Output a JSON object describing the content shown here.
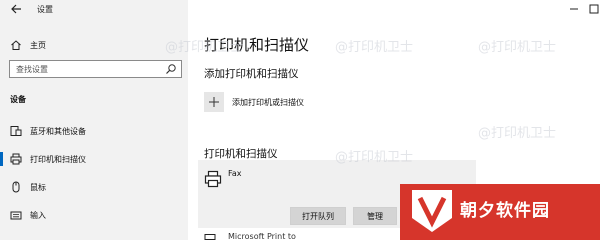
{
  "app": {
    "title": "设置"
  },
  "sidebar": {
    "home_label": "主页",
    "search_placeholder": "查找设置",
    "section_label": "设备",
    "items": [
      {
        "label": "蓝牙和其他设备",
        "icon": "bluetooth-device-icon"
      },
      {
        "label": "打印机和扫描仪",
        "icon": "printer-icon",
        "selected": true
      },
      {
        "label": "鼠标",
        "icon": "mouse-icon"
      },
      {
        "label": "输入",
        "icon": "keyboard-icon"
      }
    ]
  },
  "main": {
    "title": "打印机和扫描仪",
    "add_section": "添加打印机和扫描仪",
    "add_button_label": "添加打印机或扫描仪",
    "list_section": "打印机和扫描仪",
    "devices": [
      {
        "name": "Fax",
        "icon": "printer-icon",
        "actions": [
          "打开队列",
          "管理"
        ]
      }
    ],
    "next_device_partial": "Microsoft Print to PDF"
  },
  "watermark": {
    "text": "@打印机卫士"
  },
  "brand": {
    "text": "朝夕软件园",
    "color": "#d6352b"
  }
}
